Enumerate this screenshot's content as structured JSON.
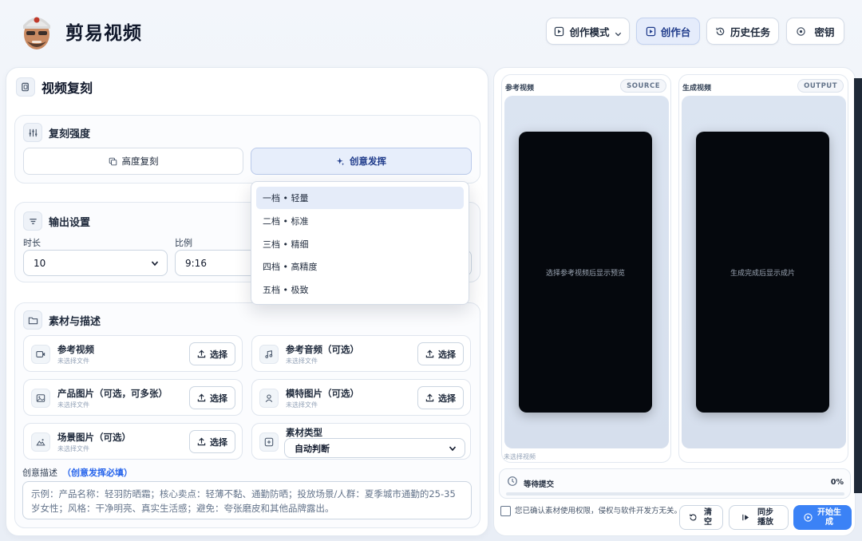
{
  "header": {
    "app_title": "剪易视频",
    "buttons": [
      {
        "label": "创作模式",
        "icon": "play-square-icon",
        "chevron": true
      },
      {
        "label": "创作台",
        "icon": "play-square-icon",
        "active": true
      },
      {
        "label": "历史任务",
        "icon": "history-icon"
      },
      {
        "label": "密钥",
        "icon": "key-icon"
      }
    ]
  },
  "left": {
    "title": "视频复刻",
    "replicate": {
      "title": "复刻强度",
      "high_label": "高度复刻",
      "creative_label": "创意发挥"
    },
    "output": {
      "title": "输出设置",
      "duration_label": "时长",
      "duration_value": "10",
      "ratio_label": "比例",
      "ratio_value": "9:16"
    },
    "dropdown": {
      "options": [
        "一档 • 轻量",
        "二档 • 标准",
        "三档 • 精细",
        "四档 • 高精度",
        "五档 • 极致"
      ],
      "selected_index": 0
    },
    "assets": {
      "title": "素材与描述",
      "pick_label": "选择",
      "no_file": "未选择文件",
      "ref_video": "参考视频",
      "ref_audio": "参考音频（可选）",
      "product_images": "产品图片（可选，可多张）",
      "model_images": "模特图片（可选）",
      "scene_images": "场景图片（可选）",
      "type_label": "素材类型",
      "type_value": "自动判断"
    },
    "description": {
      "label": "创意描述",
      "hint": "（创意发挥必填）",
      "placeholder": "示例：产品名称：轻羽防晒霜；核心卖点：轻薄不黏、通勤防晒；投放场景/人群：夏季城市通勤的25-35 岁女性；风格：干净明亮、真实生活感；避免：夸张磨皮和其他品牌露出。"
    }
  },
  "right": {
    "source": {
      "label": "参考视频",
      "tag": "SOURCE",
      "placeholder": "选择参考视频后显示预览",
      "footer": "未选择视频"
    },
    "output": {
      "label": "生成视频",
      "tag": "OUTPUT",
      "placeholder": "生成完成后显示成片"
    },
    "progress": {
      "label": "等待提交",
      "percent_text": "0%",
      "value": 0
    },
    "consent": "您已确认素材使用权限，侵权与软件开发方无关。",
    "clear_label": "清空",
    "sync_label": "同步播放",
    "start_label": "开始生成",
    "accent_color": "#3b82f6"
  }
}
